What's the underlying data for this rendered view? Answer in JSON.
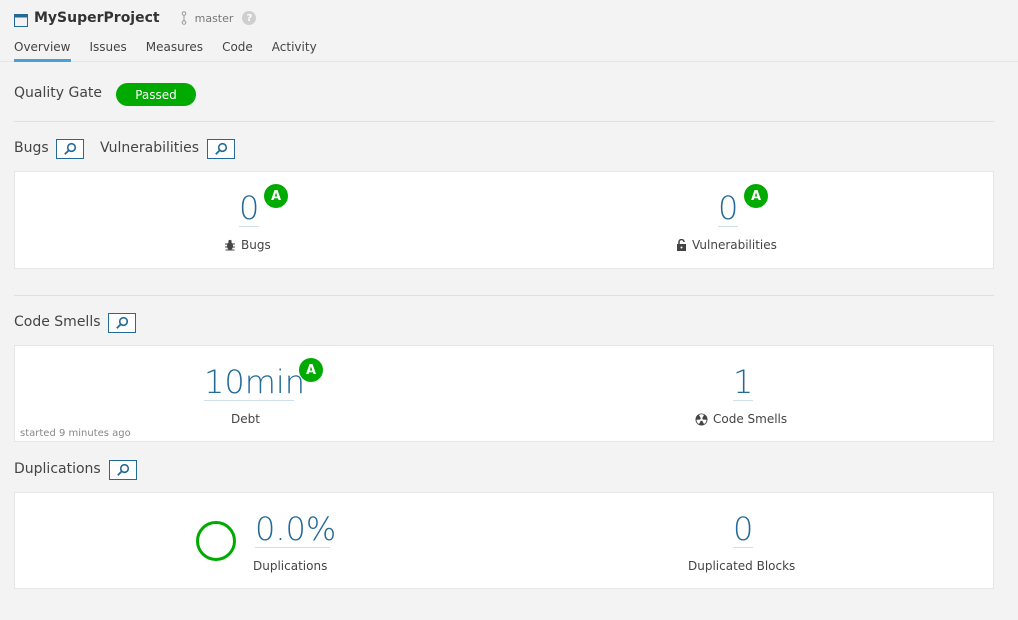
{
  "project": {
    "name": "MySuperProject",
    "branch": "master",
    "help_glyph": "?"
  },
  "tabs": [
    {
      "label": "Overview",
      "active": true
    },
    {
      "label": "Issues"
    },
    {
      "label": "Measures"
    },
    {
      "label": "Code"
    },
    {
      "label": "Activity"
    }
  ],
  "quality_gate": {
    "label": "Quality Gate",
    "status": "Passed",
    "status_color": "#00aa00"
  },
  "sections": {
    "bugs_title": "Bugs",
    "vulnerabilities_title": "Vulnerabilities",
    "code_smells_title": "Code Smells",
    "duplications_title": "Duplications"
  },
  "bugs": {
    "value": "0",
    "rating": "A",
    "label": "Bugs"
  },
  "vulnerabilities": {
    "value": "0",
    "rating": "A",
    "label": "Vulnerabilities"
  },
  "debt": {
    "value": "10min",
    "rating": "A",
    "label": "Debt",
    "started": "started 9 minutes ago"
  },
  "code_smells": {
    "value": "1",
    "label": "Code Smells"
  },
  "duplications": {
    "value": "0.0%",
    "label": "Duplications"
  },
  "duplicated_blocks": {
    "value": "0",
    "label": "Duplicated Blocks"
  },
  "colors": {
    "accent": "#236a97",
    "tab_active": "#4b9fd5",
    "rating_a": "#00aa00"
  }
}
